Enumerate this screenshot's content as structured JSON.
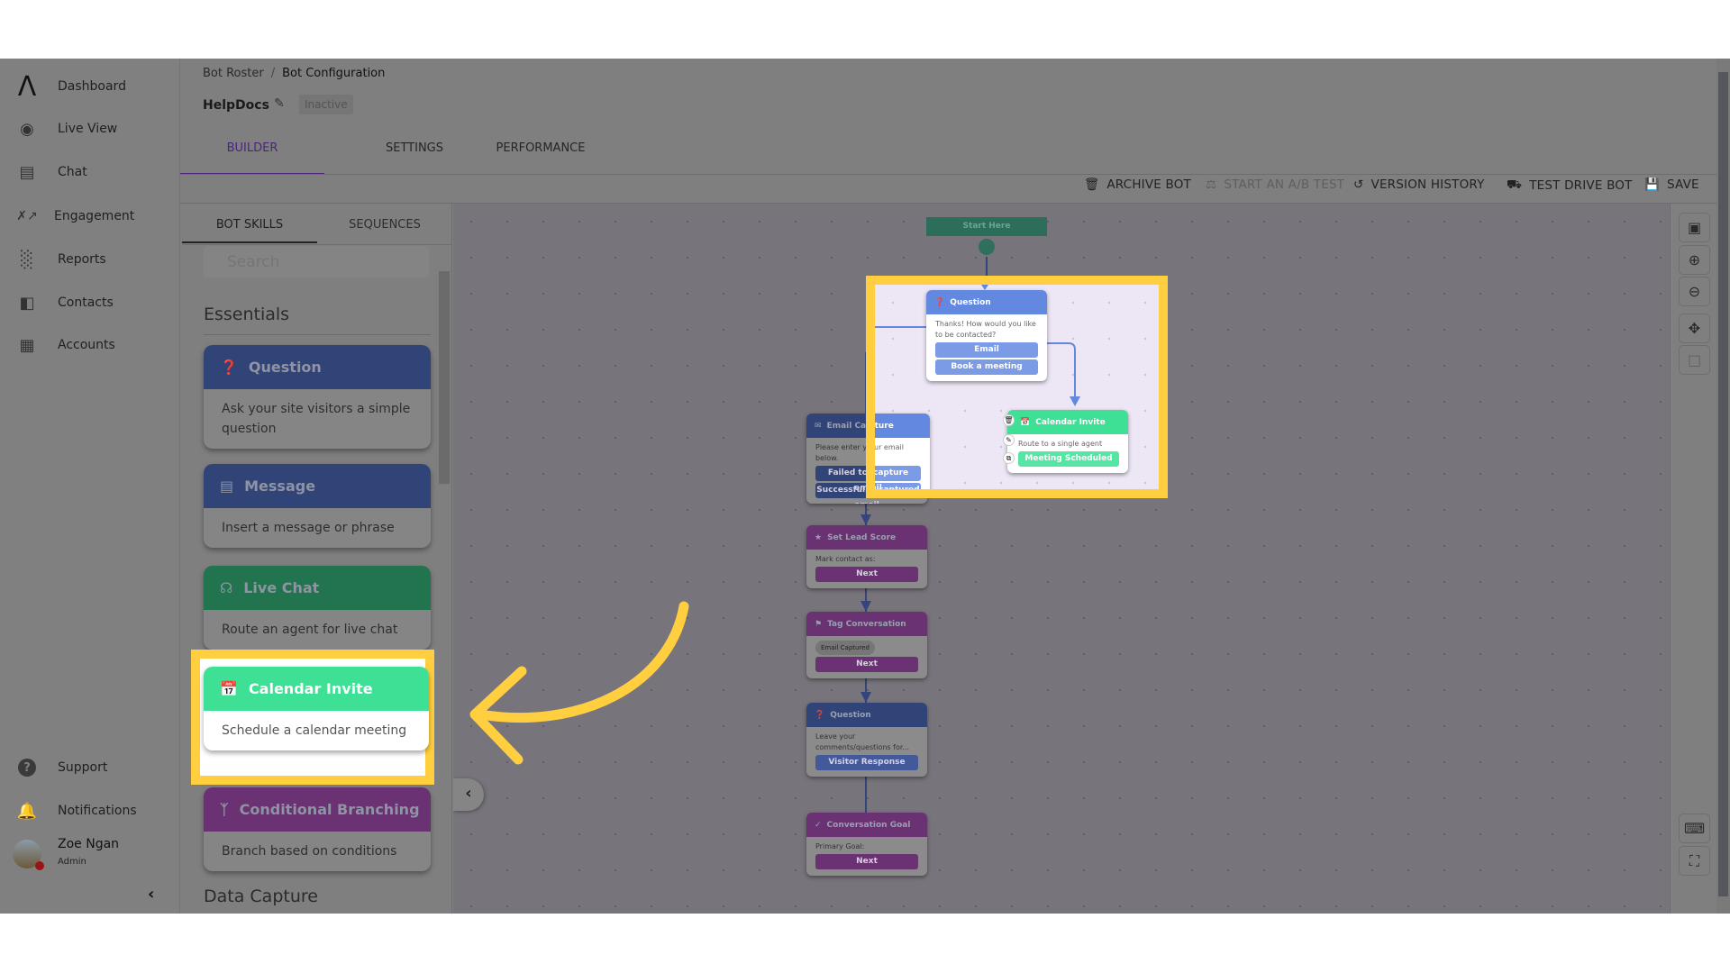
{
  "sidebar": {
    "items": [
      {
        "label": "Dashboard",
        "icon": "logo-icon"
      },
      {
        "label": "Live View",
        "icon": "globe-search-icon"
      },
      {
        "label": "Chat",
        "icon": "chat-icon"
      },
      {
        "label": "Engagement",
        "icon": "strategy-icon"
      },
      {
        "label": "Reports",
        "icon": "bar-chart-icon"
      },
      {
        "label": "Contacts",
        "icon": "contact-card-icon"
      },
      {
        "label": "Accounts",
        "icon": "building-icon"
      }
    ],
    "support": "Support",
    "notifications": "Notifications",
    "user": {
      "name": "Zoe Ngan",
      "role": "Admin"
    }
  },
  "header": {
    "breadcrumb": [
      "Bot Roster",
      "Bot Configuration"
    ],
    "bot_name": "HelpDocs",
    "status": "Inactive",
    "tabs": [
      "BUILDER",
      "SETTINGS",
      "PERFORMANCE"
    ],
    "active_tab": "BUILDER",
    "accent": "#5b2a9e"
  },
  "toolbar": {
    "archive": "ARCHIVE BOT",
    "ab_test": "START AN A/B TEST",
    "version_history": "VERSION HISTORY",
    "test_drive": "TEST DRIVE BOT",
    "save": "SAVE"
  },
  "panel": {
    "tabs": [
      "BOT SKILLS",
      "SEQUENCES"
    ],
    "search_placeholder": "Search",
    "section_essentials": "Essentials",
    "section_data_capture": "Data Capture",
    "skills": [
      {
        "title": "Question",
        "desc": "Ask your site visitors a simple question",
        "color": "#314478"
      },
      {
        "title": "Message",
        "desc": "Insert a message or phrase",
        "color": "#314478"
      },
      {
        "title": "Live Chat",
        "desc": "Route an agent for live chat",
        "color": "#21744d"
      },
      {
        "title": "Calendar Invite",
        "desc": "Schedule a calendar meeting",
        "color": "#3ee095"
      },
      {
        "title": "Conditional Branching",
        "desc": "Branch based on conditions",
        "color": "#6a3273"
      }
    ]
  },
  "canvas": {
    "start": "Start Here",
    "q1": {
      "title": "Question",
      "text": "Thanks! How would you like to be contacted?",
      "options": [
        "Email",
        "Book a meeting"
      ]
    },
    "calendar": {
      "title": "Calendar Invite",
      "text": "Route to a single agent",
      "button": "Meeting Scheduled"
    },
    "email": {
      "title": "Email Capture",
      "text": "Please enter your email below.",
      "options": [
        "Failed to capture email",
        "Successfully captured email"
      ]
    },
    "lead": {
      "title": "Set Lead Score",
      "text": "Mark contact as:",
      "button": "Next"
    },
    "tag": {
      "title": "Tag Conversation",
      "chip": "Email Captured",
      "button": "Next"
    },
    "q2": {
      "title": "Question",
      "text": "Leave your comments/questions for...",
      "button": "Visitor Response"
    },
    "goal": {
      "title": "Conversation Goal",
      "text": "Primary Goal:",
      "button": "Next"
    }
  },
  "highlight_color": "#ffcf3f"
}
